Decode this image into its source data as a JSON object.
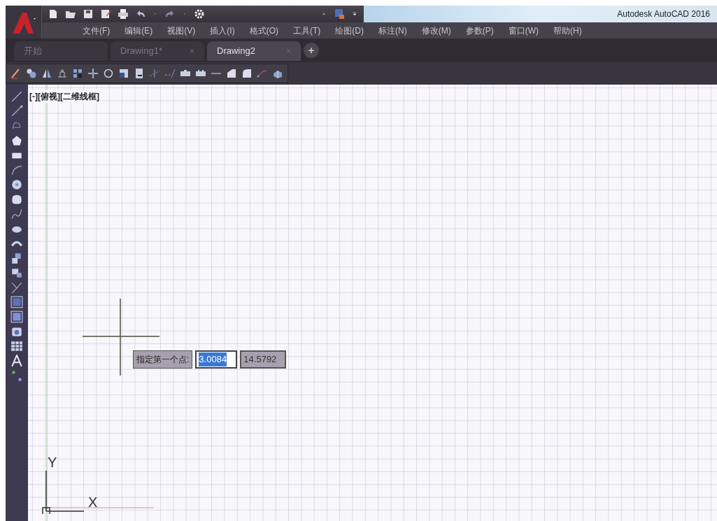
{
  "window": {
    "title": "Autodesk AutoCAD 2016"
  },
  "menu": [
    "文件(F)",
    "编辑(E)",
    "视图(V)",
    "插入(I)",
    "格式(O)",
    "工具(T)",
    "绘图(D)",
    "标注(N)",
    "修改(M)",
    "参数(P)",
    "窗口(W)",
    "帮助(H)"
  ],
  "tabs": [
    {
      "label": "开始",
      "selected": false
    },
    {
      "label": "Drawing1*",
      "selected": false,
      "close": "×"
    },
    {
      "label": "Drawing2",
      "selected": true,
      "close": "×"
    }
  ],
  "new_tab": "+",
  "viewport_label": "[-][俯视][二维线框]",
  "prompt": {
    "label": "指定第一个点:",
    "fields": [
      {
        "value": "3.0084",
        "selected": true
      },
      {
        "value": "14.5792",
        "selected": false
      }
    ]
  },
  "ucs": {
    "y_label": "Y",
    "x_label": "X"
  }
}
